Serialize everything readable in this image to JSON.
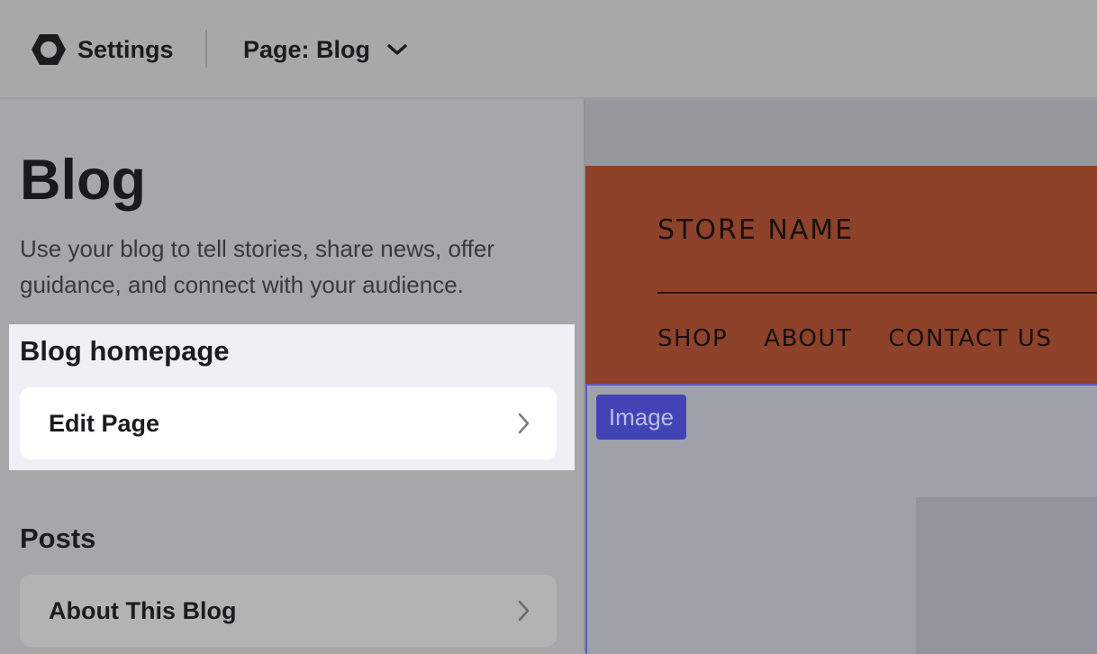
{
  "topbar": {
    "logo_icon": "hexagon-logo-icon",
    "settings_label": "Settings",
    "page_selector_label": "Page: Blog",
    "page_selector_icon": "chevron-down-icon"
  },
  "sidebar": {
    "title": "Blog",
    "description": "Use your blog to tell stories, share news, offer guidance, and connect with your audience.",
    "blog_homepage": {
      "heading": "Blog homepage",
      "items": [
        {
          "label": "Edit Page",
          "icon": "chevron-right-icon"
        }
      ]
    },
    "posts": {
      "heading": "Posts",
      "items": [
        {
          "label": "About This Blog",
          "icon": "chevron-right-icon"
        }
      ]
    }
  },
  "preview": {
    "store_name": "STORE NAME",
    "nav": [
      "SHOP",
      "ABOUT",
      "CONTACT US"
    ],
    "image_tag": "Image"
  },
  "colors": {
    "store_header_bg": "#8d4229",
    "image_tag_bg": "#4244b6",
    "highlight_bg": "#eff0f5"
  }
}
